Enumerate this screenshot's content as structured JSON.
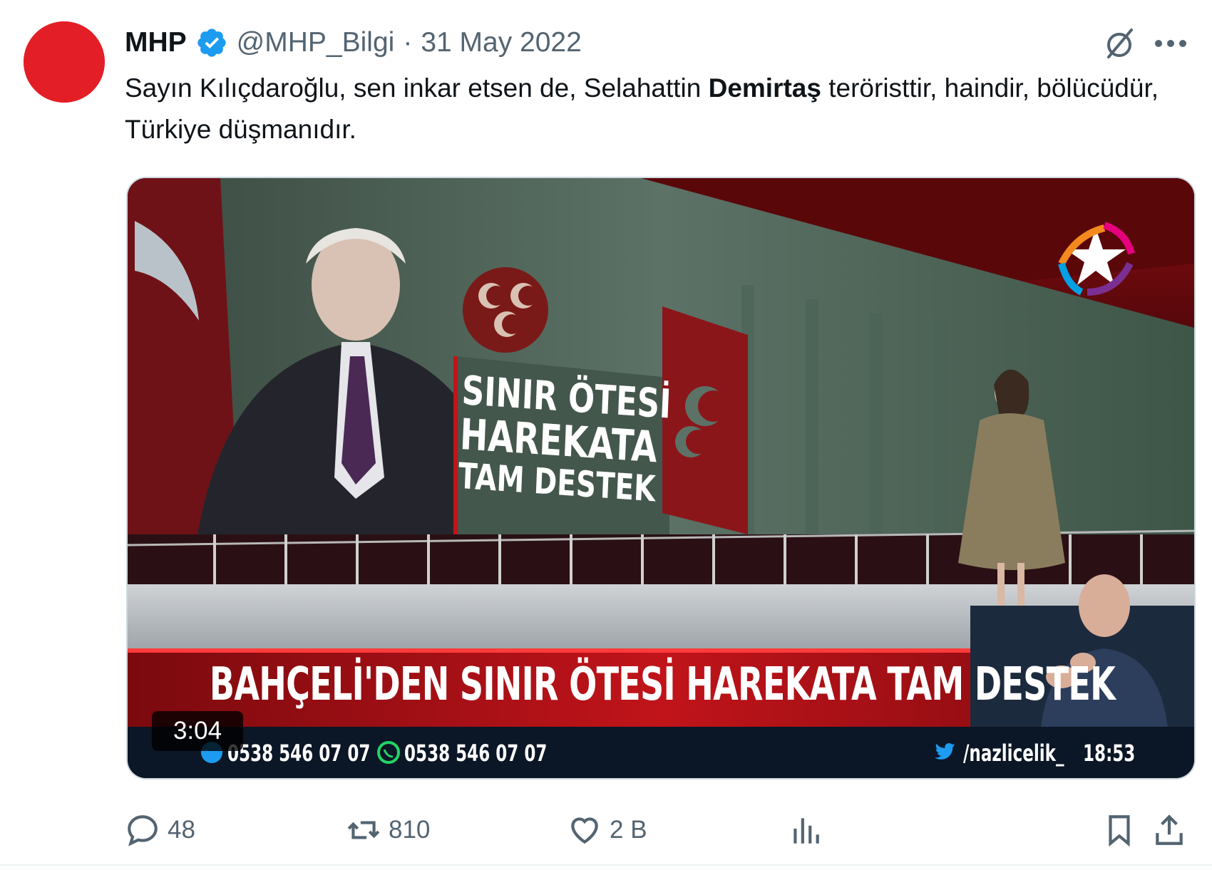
{
  "tweet": {
    "author_name": "MHP",
    "handle": "@MHP_Bilgi",
    "separator": "·",
    "date": "31 May 2022",
    "text_before": "Sayın Kılıçdaroğlu, sen inkar etsen de, Selahattin ",
    "text_bold": "Demirtaş",
    "text_after": " teröristtir, haindir, bölücüdür, Türkiye düşmanıdır."
  },
  "media": {
    "board_line1": "SINIR ÖTESİ",
    "board_line2": "HAREKATA",
    "board_line3": "TAM DESTEK",
    "headline": "BAHÇELİ'DEN SINIR ÖTESİ HAREKATA TAM DESTEK",
    "phone1": "0538 546 07 07",
    "phone2": "0538 546 07 07",
    "twitter_handle": "/nazlicelik_",
    "clock": "18:53",
    "duration": "3:04"
  },
  "actions": {
    "replies": "48",
    "retweets": "810",
    "likes": "2 B"
  },
  "colors": {
    "brand_red": "#e41e26",
    "verified_blue": "#1d9bf0",
    "muted_text": "#536471",
    "primary_text": "#0f1419"
  }
}
